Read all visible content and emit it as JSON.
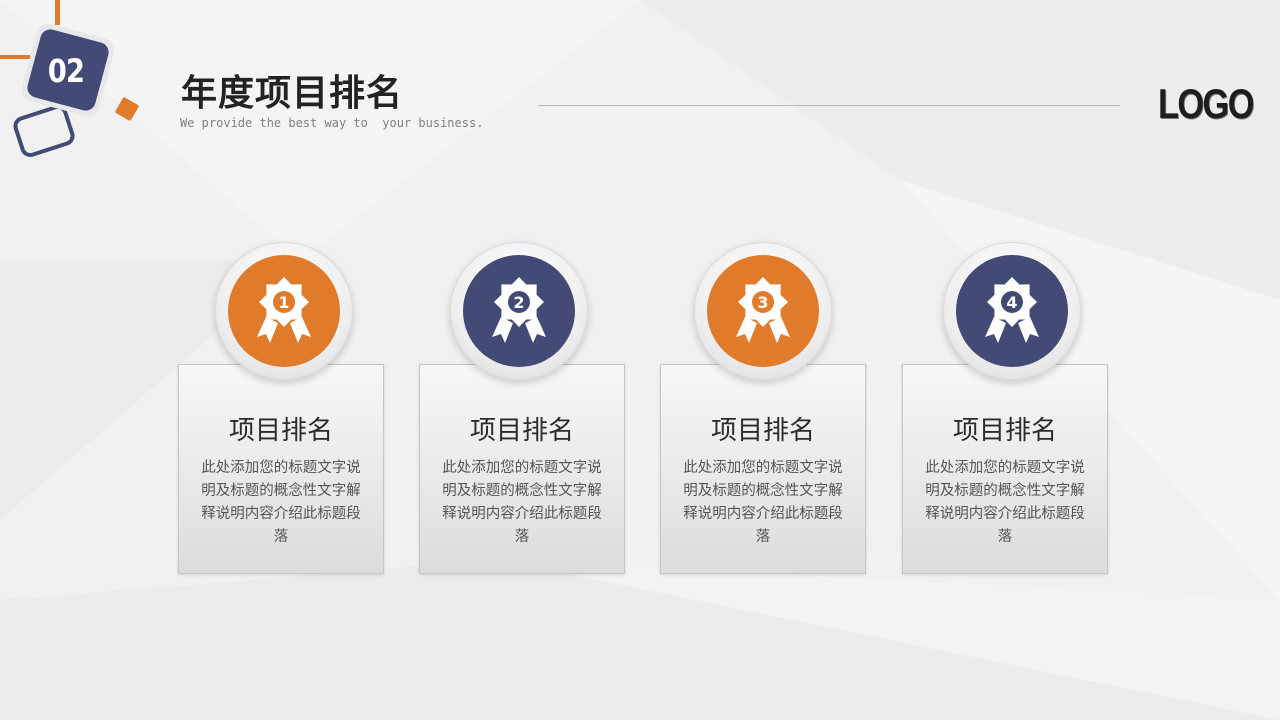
{
  "header": {
    "slide_number": "02",
    "title": "年度项目排名",
    "subtitle": "We provide the best way to  your business.",
    "logo": "LOGO"
  },
  "colors": {
    "orange": "#e07b2c",
    "navy": "#434a75",
    "background": "#f1f1f2"
  },
  "items": [
    {
      "rank": "1",
      "title": "项目排名",
      "description": "此处添加您的标题文字说明及标题的概念性文字解释说明内容介绍此标题段落",
      "color": "orange",
      "icon": "award-ribbon-icon"
    },
    {
      "rank": "2",
      "title": "项目排名",
      "description": "此处添加您的标题文字说明及标题的概念性文字解释说明内容介绍此标题段落",
      "color": "navy",
      "icon": "award-ribbon-icon"
    },
    {
      "rank": "3",
      "title": "项目排名",
      "description": "此处添加您的标题文字说明及标题的概念性文字解释说明内容介绍此标题段落",
      "color": "orange",
      "icon": "award-ribbon-icon"
    },
    {
      "rank": "4",
      "title": "项目排名",
      "description": "此处添加您的标题文字说明及标题的概念性文字解释说明内容介绍此标题段落",
      "color": "navy",
      "icon": "award-ribbon-icon"
    }
  ]
}
